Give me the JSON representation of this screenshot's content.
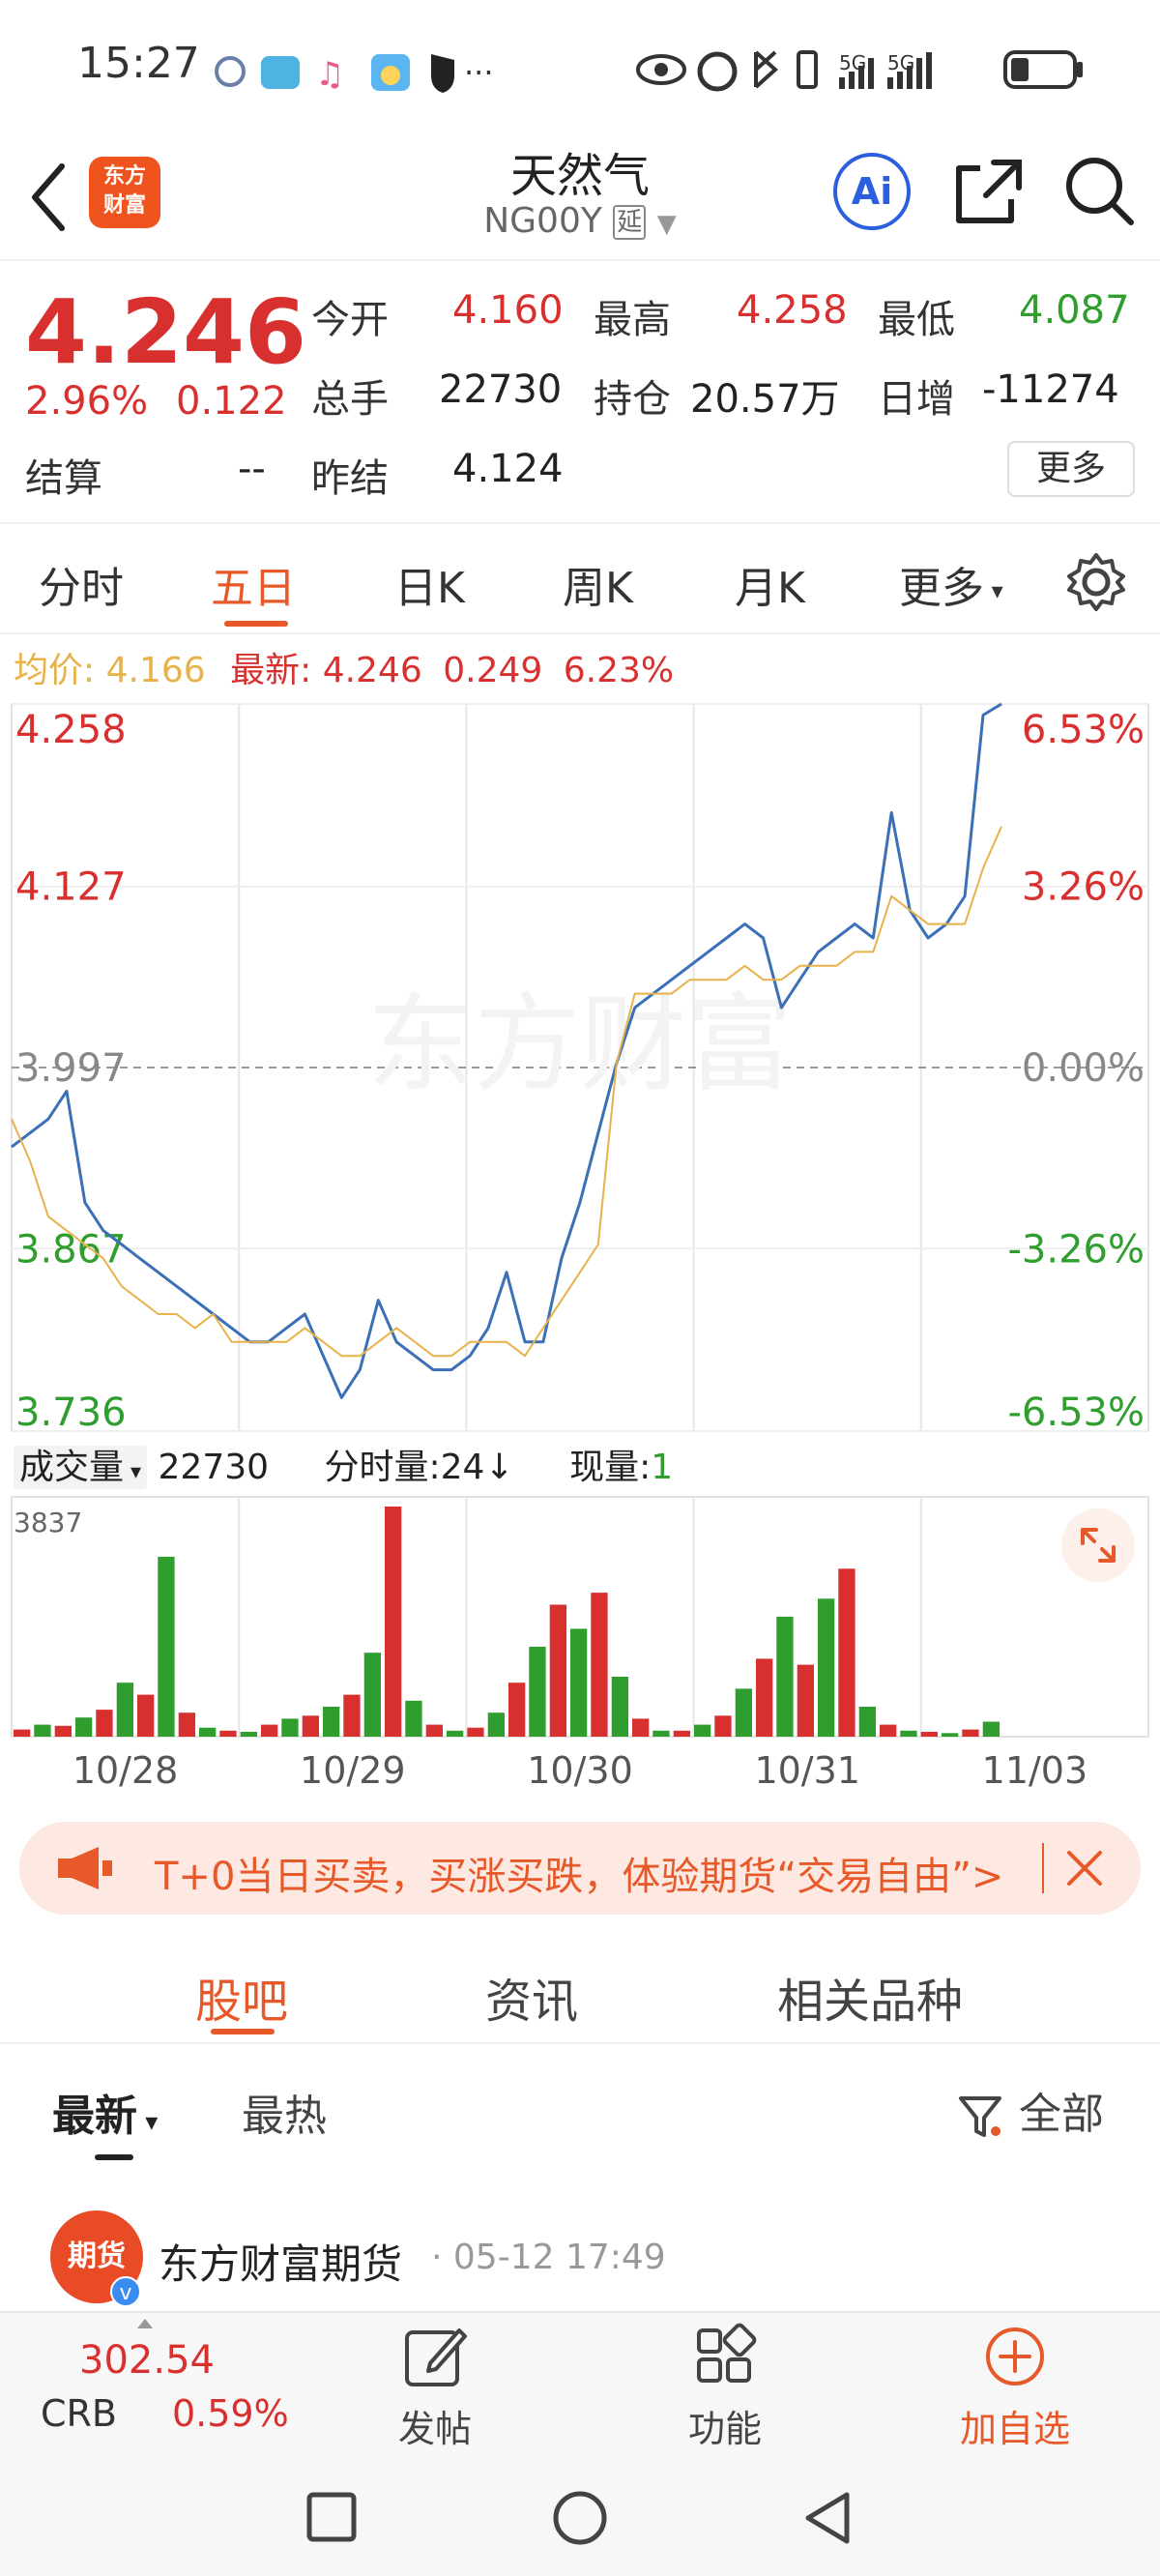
{
  "status_bar": {
    "time": "15:27",
    "signal1": "5G",
    "signal2": "5G"
  },
  "header": {
    "logo_line1": "东方",
    "logo_line2": "财富",
    "title": "天然气",
    "code": "NG00Y",
    "delay_badge": "延",
    "ai_label": "Ai"
  },
  "quote": {
    "price": "4.246",
    "change_pct": "2.96%",
    "change": "0.122",
    "rows": [
      {
        "label": "今开",
        "value": "4.160",
        "color": "red"
      },
      {
        "label": "最高",
        "value": "4.258",
        "color": "red"
      },
      {
        "label": "最低",
        "value": "4.087",
        "color": "green"
      },
      {
        "label": "总手",
        "value": "22730",
        "color": "black"
      },
      {
        "label": "持仓",
        "value": "20.57万",
        "color": "black"
      },
      {
        "label": "日增",
        "value": "-11274",
        "color": "black"
      }
    ],
    "settle_label": "结算",
    "settle_value": "--",
    "prev_settle_label": "昨结",
    "prev_settle_value": "4.124",
    "more_button": "更多"
  },
  "tabs": [
    "分时",
    "五日",
    "日K",
    "周K",
    "月K",
    "更多"
  ],
  "active_tab_index": 1,
  "chart_info": {
    "avg_label": "均价:",
    "avg_value": "4.166",
    "latest_label": "最新:",
    "latest_value": "4.246",
    "latest_change": "0.249",
    "latest_pct": "6.23%"
  },
  "volume_info": {
    "selector": "成交量",
    "volume": "22730",
    "minute_label": "分时量:24↓",
    "current_label": "现量:",
    "current_value": "1"
  },
  "watermark": "东方财富",
  "chart_data": [
    {
      "type": "line",
      "title": "",
      "x": [
        "10/28",
        "10/29",
        "10/30",
        "10/31",
        "11/03"
      ],
      "y_ticks_left": [
        "4.258",
        "4.127",
        "3.997",
        "3.867",
        "3.736"
      ],
      "y_ticks_right": [
        "6.53%",
        "3.26%",
        "0.00%",
        "-3.26%",
        "-6.53%"
      ],
      "ylim": [
        3.736,
        4.258
      ],
      "reference_line": 3.997,
      "series": [
        {
          "name": "最新",
          "color": "#3b6fb6",
          "values": [
            3.94,
            3.95,
            3.96,
            3.98,
            3.9,
            3.88,
            3.87,
            3.86,
            3.85,
            3.84,
            3.83,
            3.82,
            3.81,
            3.8,
            3.8,
            3.81,
            3.82,
            3.79,
            3.76,
            3.78,
            3.83,
            3.8,
            3.79,
            3.78,
            3.78,
            3.79,
            3.81,
            3.85,
            3.8,
            3.8,
            3.86,
            3.9,
            3.95,
            4.0,
            4.04,
            4.05,
            4.06,
            4.07,
            4.08,
            4.09,
            4.1,
            4.09,
            4.04,
            4.06,
            4.08,
            4.09,
            4.1,
            4.09,
            4.18,
            4.11,
            4.09,
            4.1,
            4.12,
            4.25,
            4.258
          ]
        },
        {
          "name": "均价",
          "color": "#e8b24a",
          "values": [
            3.96,
            3.93,
            3.89,
            3.88,
            3.87,
            3.86,
            3.84,
            3.83,
            3.82,
            3.82,
            3.81,
            3.82,
            3.8,
            3.8,
            3.8,
            3.8,
            3.81,
            3.8,
            3.79,
            3.79,
            3.8,
            3.81,
            3.8,
            3.79,
            3.79,
            3.8,
            3.8,
            3.8,
            3.79,
            3.81,
            3.83,
            3.85,
            3.87,
            4.0,
            4.05,
            4.05,
            4.05,
            4.06,
            4.06,
            4.06,
            4.07,
            4.06,
            4.06,
            4.07,
            4.07,
            4.07,
            4.08,
            4.08,
            4.12,
            4.11,
            4.1,
            4.1,
            4.1,
            4.14,
            4.17
          ]
        }
      ]
    },
    {
      "type": "bar",
      "title": "",
      "ylabel": "3837",
      "ylim": [
        0,
        3837
      ],
      "series": [
        {
          "name": "成交量",
          "values": [
            120,
            200,
            180,
            320,
            450,
            900,
            700,
            3000,
            400,
            150,
            100,
            80,
            200,
            300,
            350,
            500,
            700,
            1400,
            3837,
            600,
            200,
            100,
            150,
            400,
            900,
            1500,
            2200,
            1800,
            2400,
            1000,
            300,
            100,
            100,
            200,
            350,
            800,
            1300,
            2000,
            1200,
            2300,
            2800,
            500,
            200,
            100,
            80,
            60,
            120,
            250
          ]
        }
      ]
    }
  ],
  "banner": {
    "text": "T+0当日买卖，买涨买跌，体验期货“交易自由”>"
  },
  "lower_tabs": [
    "股吧",
    "资讯",
    "相关品种"
  ],
  "feed": {
    "sort_latest": "最新",
    "sort_hot": "最热",
    "filter_label": "全部"
  },
  "post": {
    "avatar_text": "期货",
    "author": "东方财富期货",
    "time": "05-12 17:49"
  },
  "bottom_bar": {
    "index_value": "302.54",
    "index_name": "CRB",
    "index_change": "0.59%",
    "post_label": "发帖",
    "function_label": "功能",
    "add_label": "加自选"
  },
  "colors": {
    "up": "#d8302f",
    "down": "#2f9e2f",
    "accent": "#e8592a",
    "price_line": "#3b6fb6",
    "avg_line": "#e8b24a"
  }
}
